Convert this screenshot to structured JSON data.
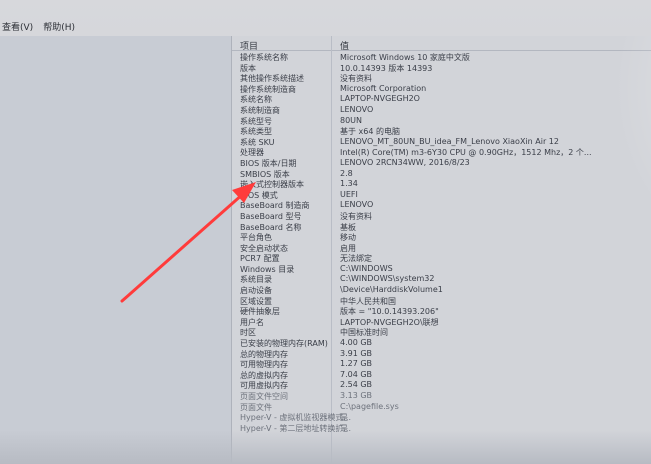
{
  "menu": {
    "view": "查看(V)",
    "help": "帮助(H)"
  },
  "table": {
    "col_item": "项目",
    "col_value": "值",
    "rows": [
      {
        "k": "操作系统名称",
        "v": "Microsoft Windows 10 家庭中文版"
      },
      {
        "k": "版本",
        "v": "10.0.14393 版本 14393"
      },
      {
        "k": "其他操作系统描述",
        "v": "没有资料"
      },
      {
        "k": "操作系统制造商",
        "v": "Microsoft Corporation"
      },
      {
        "k": "系统名称",
        "v": "LAPTOP-NVGEGH2O"
      },
      {
        "k": "系统制造商",
        "v": "LENOVO"
      },
      {
        "k": "系统型号",
        "v": "80UN"
      },
      {
        "k": "系统类型",
        "v": "基于 x64 的电脑"
      },
      {
        "k": "系统 SKU",
        "v": "LENOVO_MT_80UN_BU_idea_FM_Lenovo XiaoXin Air 12"
      },
      {
        "k": "处理器",
        "v": "Intel(R) Core(TM) m3-6Y30 CPU @ 0.90GHz，1512 Mhz，2 个..."
      },
      {
        "k": "BIOS 版本/日期",
        "v": "LENOVO 2RCN34WW, 2016/8/23"
      },
      {
        "k": "SMBIOS 版本",
        "v": "2.8"
      },
      {
        "k": "嵌入式控制器版本",
        "v": "1.34"
      },
      {
        "k": "BIOS 模式",
        "v": "UEFI"
      },
      {
        "k": "BaseBoard 制造商",
        "v": "LENOVO"
      },
      {
        "k": "BaseBoard 型号",
        "v": "没有资料"
      },
      {
        "k": "BaseBoard 名称",
        "v": "基板"
      },
      {
        "k": "平台角色",
        "v": "移动"
      },
      {
        "k": "安全启动状态",
        "v": "启用"
      },
      {
        "k": "PCR7 配置",
        "v": "无法绑定"
      },
      {
        "k": "Windows 目录",
        "v": "C:\\WINDOWS"
      },
      {
        "k": "系统目录",
        "v": "C:\\WINDOWS\\system32"
      },
      {
        "k": "启动设备",
        "v": "\\Device\\HarddiskVolume1"
      },
      {
        "k": "区域设置",
        "v": "中华人民共和国"
      },
      {
        "k": "硬件抽象层",
        "v": "版本 = \"10.0.14393.206\""
      },
      {
        "k": "用户名",
        "v": "LAPTOP-NVGEGH2O\\联想"
      },
      {
        "k": "时区",
        "v": "中国标准时间"
      },
      {
        "k": "已安装的物理内存(RAM)",
        "v": "4.00 GB"
      },
      {
        "k": "总的物理内存",
        "v": "3.91 GB"
      },
      {
        "k": "可用物理内存",
        "v": "1.27 GB"
      },
      {
        "k": "总的虚拟内存",
        "v": "7.04 GB"
      },
      {
        "k": "可用虚拟内存",
        "v": "2.54 GB"
      },
      {
        "k": "页面文件空间",
        "v": "3.13 GB"
      },
      {
        "k": "页面文件",
        "v": "C:\\pagefile.sys"
      },
      {
        "k": "Hyper-V - 虚拟机监视器模式...",
        "v": "是"
      },
      {
        "k": "Hyper-V - 第二层地址转换扩...",
        "v": "是"
      }
    ]
  },
  "colors": {
    "arrow": "#ff3b3b"
  }
}
